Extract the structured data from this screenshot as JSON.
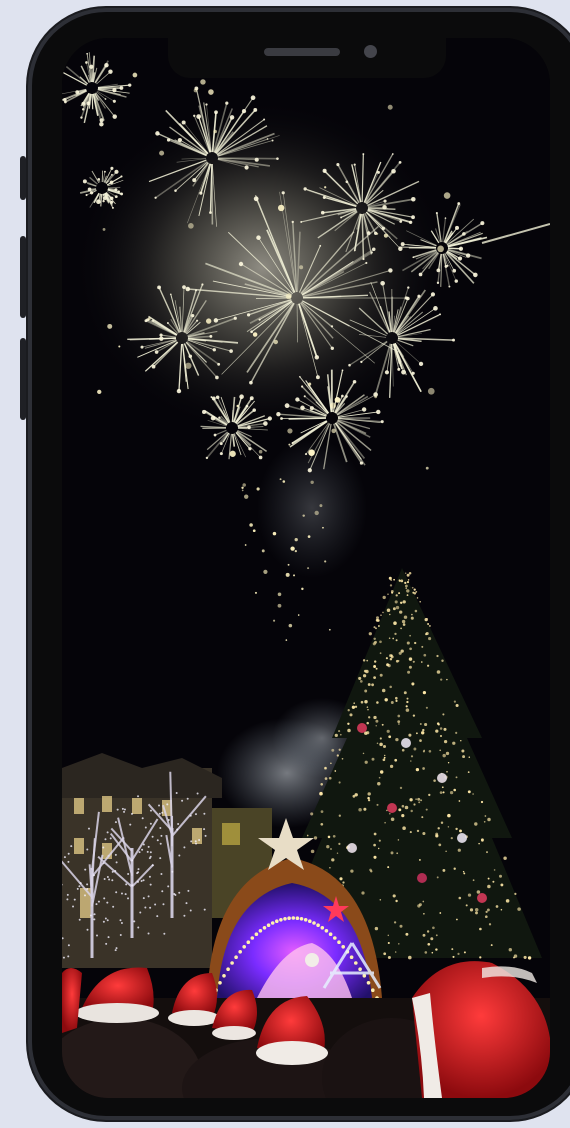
{
  "device": {
    "type": "smartphone",
    "frame_color": "#0b0b0c",
    "background_color": "#dfe3ef"
  },
  "photo": {
    "subject": "fireworks",
    "elements": [
      "fireworks",
      "christmas-tree",
      "nativity-stage",
      "star",
      "buildings",
      "crowd",
      "santa-hats",
      "smoke"
    ],
    "colors": {
      "sky": "#040308",
      "spark": "#f3f2d8",
      "stage_light": "#7a2cff",
      "tree_light": "#ffe9a8",
      "hat_red": "#c9141a"
    }
  }
}
